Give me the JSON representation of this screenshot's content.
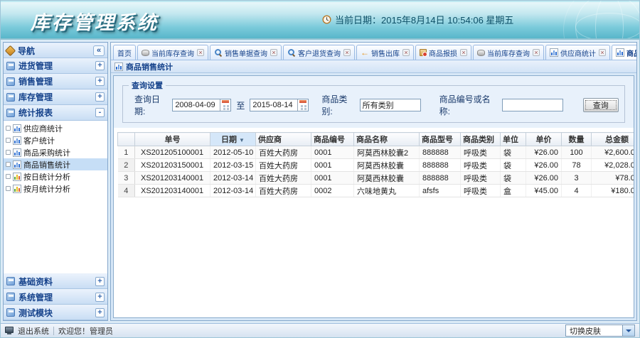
{
  "colors": {
    "header_teal": "#5fb9cd",
    "accent_blue": "#15428b",
    "selected_item_bg": "#c6def6",
    "panel_bg": "#e8f1fb"
  },
  "header": {
    "title": "库存管理系统",
    "datetime_label": "当前日期：2015年8月14日 10:54:06 星期五"
  },
  "sidebar": {
    "nav_title": "导航",
    "collapse_glyph": "«",
    "groups": [
      {
        "label": "进货管理",
        "state": "+"
      },
      {
        "label": "销售管理",
        "state": "+"
      },
      {
        "label": "库存管理",
        "state": "+"
      },
      {
        "label": "统计报表",
        "state": "-"
      }
    ],
    "report_items": [
      {
        "label": "供应商统计",
        "icon": "chart-blue-icon",
        "selected": false
      },
      {
        "label": "客户统计",
        "icon": "chart-blue-icon",
        "selected": false
      },
      {
        "label": "商品采购统计",
        "icon": "chart-blue-icon",
        "selected": false
      },
      {
        "label": "商品销售统计",
        "icon": "chart-blue-icon",
        "selected": true
      },
      {
        "label": "按日统计分析",
        "icon": "chart-color-icon",
        "selected": false
      },
      {
        "label": "按月统计分析",
        "icon": "chart-color-icon",
        "selected": false
      }
    ],
    "bottom_groups": [
      {
        "label": "基础资料",
        "state": "+"
      },
      {
        "label": "系统管理",
        "state": "+"
      },
      {
        "label": "测试模块",
        "state": "+"
      }
    ]
  },
  "tabs": [
    {
      "label": "首页",
      "closable": false,
      "active": false
    },
    {
      "label": "当前库存查询",
      "icon": "database-icon",
      "closable": true,
      "active": false
    },
    {
      "label": "销售单据查询",
      "icon": "search-icon",
      "closable": true,
      "active": false
    },
    {
      "label": "客户退货查询",
      "icon": "search-icon",
      "closable": true,
      "active": false
    },
    {
      "label": "销售出库",
      "icon": "arrow-out-icon",
      "closable": true,
      "active": false
    },
    {
      "label": "商品报损",
      "icon": "box-alert-icon",
      "closable": true,
      "active": false
    },
    {
      "label": "当前库存查询",
      "icon": "database-icon",
      "closable": true,
      "active": false
    },
    {
      "label": "供应商统计",
      "icon": "chart-icon",
      "closable": true,
      "active": false
    },
    {
      "label": "商品销售统计",
      "icon": "chart-icon",
      "closable": true,
      "active": true
    }
  ],
  "panel": {
    "title": "商品销售统计"
  },
  "query": {
    "legend": "查询设置",
    "date_label": "查询日期:",
    "date_from": "2008-04-09",
    "to_word": "至",
    "date_to": "2015-08-14",
    "category_label": "商品类别:",
    "category_value": "所有类别",
    "keyword_label": "商品编号或名称:",
    "keyword_value": "",
    "search_button": "查询"
  },
  "table": {
    "columns": [
      "",
      "单号",
      "日期",
      "供应商",
      "商品编号",
      "商品名称",
      "商品型号",
      "商品类别",
      "单位",
      "单价",
      "数量",
      "总金额"
    ],
    "sort_column": "日期",
    "sort_direction": "desc",
    "sort_glyph": "▼",
    "rows": [
      [
        "1",
        "XS201205100001",
        "2012-05-10",
        "百姓大药房",
        "0001",
        "阿莫西林胶囊2",
        "888888",
        "呼吸类",
        "袋",
        "¥26.00",
        "100",
        "¥2,600.00"
      ],
      [
        "2",
        "XS201203150001",
        "2012-03-15",
        "百姓大药房",
        "0001",
        "阿莫西林胶囊",
        "888888",
        "呼吸类",
        "袋",
        "¥26.00",
        "78",
        "¥2,028.00"
      ],
      [
        "3",
        "XS201203140001",
        "2012-03-14",
        "百姓大药房",
        "0001",
        "阿莫西林胶囊",
        "888888",
        "呼吸类",
        "袋",
        "¥26.00",
        "3",
        "¥78.00"
      ],
      [
        "4",
        "XS201203140001",
        "2012-03-14",
        "百姓大药房",
        "0002",
        "六味地黄丸",
        "afsfs",
        "呼吸类",
        "盒",
        "¥45.00",
        "4",
        "¥180.00"
      ]
    ]
  },
  "footer": {
    "exit_label": "退出系统",
    "welcome_label": "欢迎您！管理员",
    "skin_label": "切换皮肤"
  }
}
